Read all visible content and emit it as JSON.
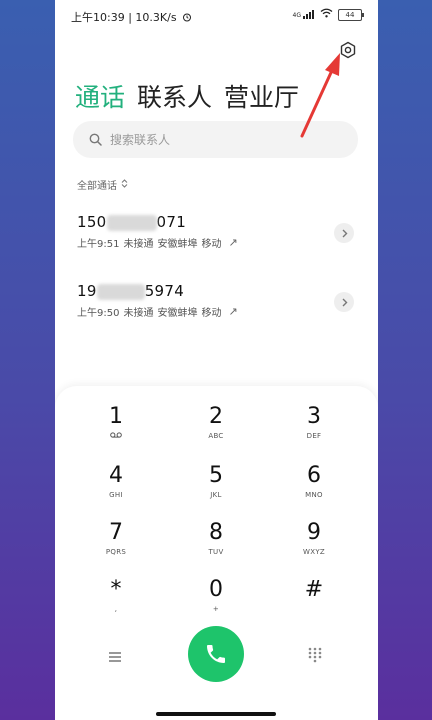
{
  "status_bar": {
    "time": "上午10:39",
    "network_speed": "10.3K/s",
    "signal": "4G",
    "battery": "44"
  },
  "tabs": [
    {
      "label": "通话",
      "active": true
    },
    {
      "label": "联系人",
      "active": false
    },
    {
      "label": "营业厅",
      "active": false
    }
  ],
  "search": {
    "placeholder": "搜索联系人"
  },
  "filter": {
    "label": "全部通话"
  },
  "calls": [
    {
      "number_prefix": "150",
      "number_suffix": "071",
      "time": "上午9:51",
      "status": "未接通",
      "location": "安徽蚌埠",
      "carrier": "移动"
    },
    {
      "number_prefix": "19",
      "number_suffix": "5974",
      "time": "上午9:50",
      "status": "未接通",
      "location": "安徽蚌埠",
      "carrier": "移动"
    }
  ],
  "keypad": [
    {
      "digit": "1",
      "letters": "voicemail-icon"
    },
    {
      "digit": "2",
      "letters": "ABC"
    },
    {
      "digit": "3",
      "letters": "DEF"
    },
    {
      "digit": "4",
      "letters": "GHI"
    },
    {
      "digit": "5",
      "letters": "JKL"
    },
    {
      "digit": "6",
      "letters": "MNO"
    },
    {
      "digit": "7",
      "letters": "PQRS"
    },
    {
      "digit": "8",
      "letters": "TUV"
    },
    {
      "digit": "9",
      "letters": "WXYZ"
    },
    {
      "digit": "*",
      "letters": ","
    },
    {
      "digit": "0",
      "letters": "+"
    },
    {
      "digit": "#",
      "letters": ""
    }
  ],
  "colors": {
    "accent": "#22b07d",
    "call_button": "#1ec46b",
    "annotation_arrow": "#e53935"
  }
}
